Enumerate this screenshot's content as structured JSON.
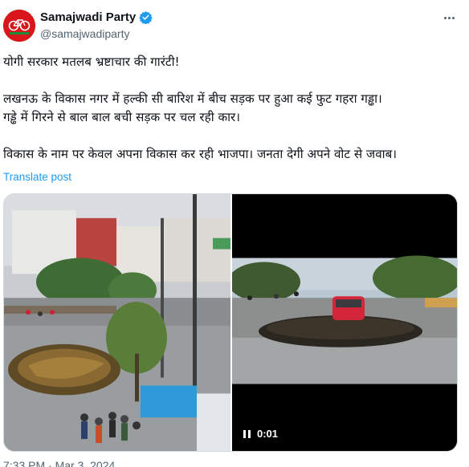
{
  "post": {
    "author": {
      "display_name": "Samajwadi Party",
      "handle": "@samajwadiparty",
      "verified": true,
      "avatar_icon": "bicycle-party-logo-icon",
      "avatar_color": "#d8161c"
    },
    "text_lines": [
      "योगी सरकार मतलब भ्रष्टाचार की गारंटी!",
      "लखनऊ के विकास नगर में हल्की सी बारिश में बीच सड़क पर हुआ कई फुट गहरा गड्ढा।",
      "गड्ढे में गिरने से बाल बाल बची सड़क पर चल रही कार।",
      "विकास के नाम पर केवल अपना विकास कर रही भाजपा। जनता देगी अपने वोट से जवाब।"
    ],
    "translate_label": "Translate post",
    "video": {
      "time": "0:01",
      "state": "playing"
    },
    "timestamp": "7:33 PM · Mar 3, 2024"
  },
  "colors": {
    "accent": "#1d9bf0",
    "secondary_text": "#536471",
    "verified_badge": "#1d9bf0"
  }
}
